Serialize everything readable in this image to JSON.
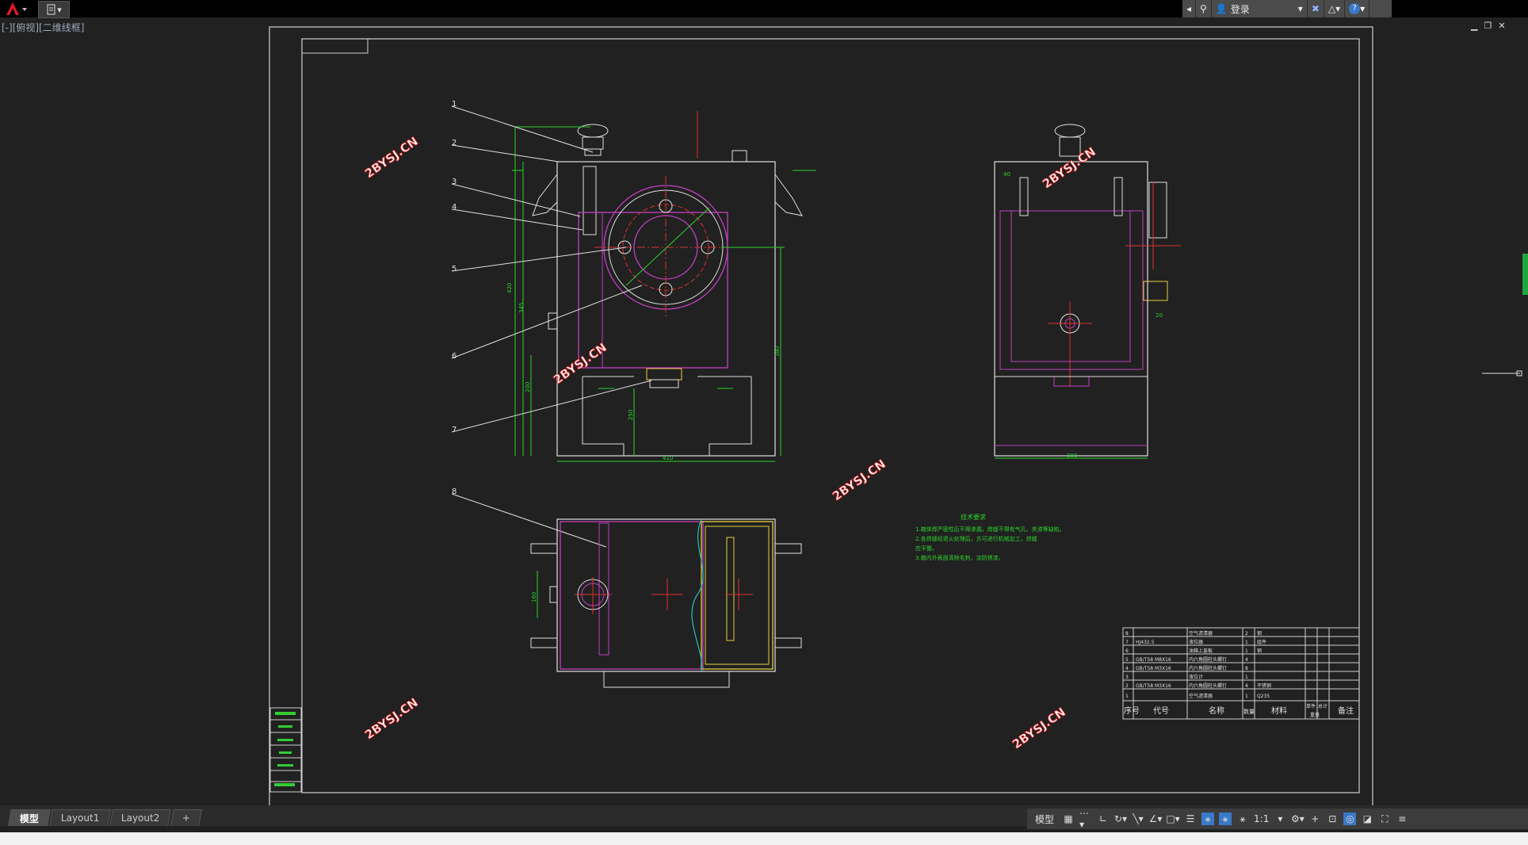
{
  "app": {
    "name": "AutoCAD",
    "qa_label": "▾"
  },
  "search": {
    "login_label": "登录"
  },
  "viewport": {
    "label": "[-][俯视][二维线框]"
  },
  "drawing": {
    "balloons": [
      "1",
      "2",
      "3",
      "4",
      "5",
      "6",
      "7",
      "8"
    ],
    "watermark": "2BYSJ.CN",
    "tech_title": "技术要求",
    "tech_lines": [
      "1.箱体焊严密性后不得渗漏，焊缝不得有气孔、夹渣等缺陷。",
      "2.各焊缝经退火处理后，方可进行机械加工，焊缝",
      "应平整。",
      "3.箱内外表面清除毛刺，涂防锈漆。"
    ],
    "dims": {
      "d1": "420",
      "d2": "345",
      "d3": "200",
      "d4": "250",
      "d5": "380",
      "d6": "410",
      "d7": "300",
      "d8": "40",
      "d9": "20",
      "d10": "160"
    },
    "bom": {
      "rows": [
        [
          "8",
          "",
          "空气滤清器",
          "2",
          "钢"
        ],
        [
          "7",
          "HJ432.5",
          "液位器",
          "1",
          "组件"
        ],
        [
          "6",
          "",
          "油箱上盖板",
          "1",
          "钢"
        ],
        [
          "5",
          "GB/T58 M8X16",
          "内六角圆柱头螺钉",
          "4",
          ""
        ],
        [
          "4",
          "GB/T58 M3X16",
          "内六角圆柱头螺钉",
          "8",
          ""
        ],
        [
          "3",
          "",
          "液位计",
          "1",
          ""
        ],
        [
          "2",
          "GB/T58 M3X16",
          "内六角圆柱头螺钉",
          "4",
          "不锈钢"
        ],
        [
          "1",
          "",
          "空气滤清器",
          "1",
          "Q235"
        ]
      ],
      "header": {
        "seq": "序号",
        "code": "代号",
        "name": "名称",
        "qty": "数量",
        "material": "材料",
        "unit": "单件",
        "total": "总计",
        "weight": "重量",
        "remark": "备注"
      }
    }
  },
  "tabs": [
    {
      "label": "模型"
    },
    {
      "label": "Layout1"
    },
    {
      "label": "Layout2"
    },
    {
      "label": "+"
    }
  ],
  "status": {
    "model": "模型",
    "scale": "1:1"
  }
}
